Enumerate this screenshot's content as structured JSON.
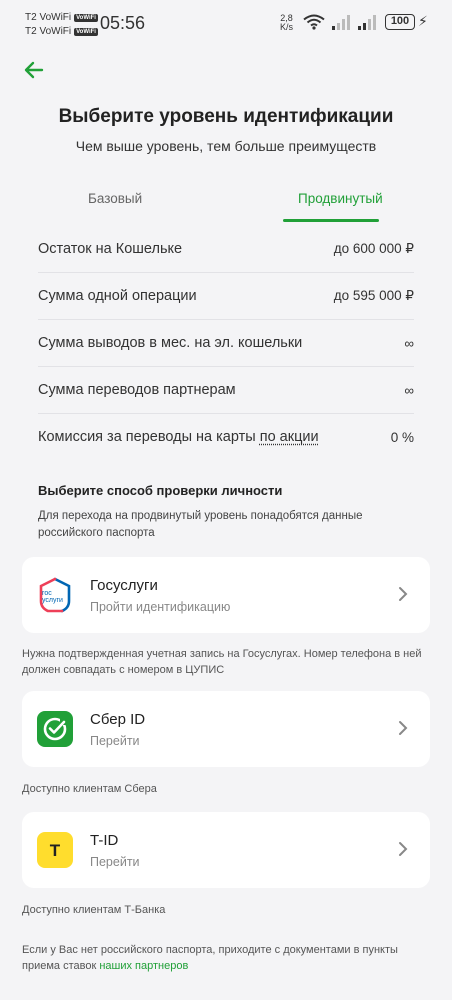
{
  "status_bar": {
    "carrier1": "T2 VoWiFi",
    "carrier2": "T2 VoWiFi",
    "vowifi_badge": "VoWiFi",
    "time": "05:56",
    "net_speed_value": "2,8",
    "net_speed_unit": "K/s",
    "battery": "100"
  },
  "header": {
    "title": "Выберите уровень идентификации",
    "subtitle": "Чем выше уровень, тем больше преимуществ"
  },
  "tabs": [
    {
      "label": "Базовый",
      "active": false
    },
    {
      "label": "Продвинутый",
      "active": true
    }
  ],
  "limits": [
    {
      "label": "Остаток на Кошельке",
      "value": "до 600 000 ₽"
    },
    {
      "label": "Сумма одной операции",
      "value": "до 595 000 ₽"
    },
    {
      "label": "Сумма выводов в мес. на эл. кошельки",
      "value": "∞"
    },
    {
      "label": "Сумма переводов партнерам",
      "value": "∞"
    },
    {
      "label": "Комиссия за переводы на карты ",
      "link": "по акции",
      "value": "0 %"
    }
  ],
  "verify": {
    "title": "Выберите способ проверки личности",
    "description": "Для перехода на продвинутый уровень понадобятся данные российского паспорта"
  },
  "methods": [
    {
      "name": "Госуслуги",
      "subtitle": "Пройти идентификацию",
      "logo_text1": "гос",
      "logo_text2": "услуги",
      "note": "Нужна подтвержденная учетная запись на Госуслугах. Номер телефона в ней должен совпадать с номером в ЦУПИС"
    },
    {
      "name": "Сбер ID",
      "subtitle": "Перейти",
      "note": "Доступно клиентам Сбера"
    },
    {
      "name": "T-ID",
      "subtitle": "Перейти",
      "logo_text": "Т",
      "note": "Доступно клиентам Т-Банка"
    }
  ],
  "footer": {
    "text": "Если у Вас нет российского паспорта, приходите с документами в пункты приема ставок ",
    "link": "наших партнеров"
  },
  "colors": {
    "accent": "#21a038",
    "background": "#f4f4f6",
    "tinkoff_yellow": "#ffdd2d"
  }
}
